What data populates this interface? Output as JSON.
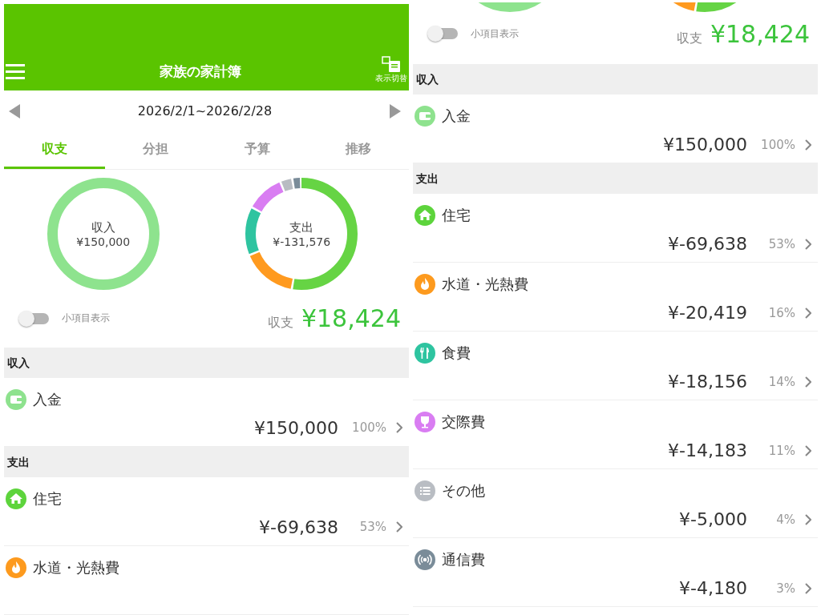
{
  "panels": [
    {
      "kind": "top",
      "header": {
        "title": "家族の家計簿",
        "view_toggle_label": "表示切替"
      },
      "date_range": "2026/2/1~2026/2/28",
      "tabs": [
        {
          "label": "収支",
          "selected": true
        },
        {
          "label": "分担",
          "selected": false
        },
        {
          "label": "予算",
          "selected": false
        },
        {
          "label": "推移",
          "selected": false
        }
      ],
      "donuts": [
        {
          "kind": "income",
          "label": "収入",
          "amount": "¥150,000"
        },
        {
          "kind": "expense",
          "label": "支出",
          "amount": "¥-131,576"
        }
      ],
      "subitem_toggle": {
        "label": "小項目表示",
        "on": false
      },
      "balance": {
        "label": "収支",
        "amount": "¥18,424"
      },
      "sections": [
        {
          "title": "収入",
          "rows": [
            {
              "kind": "deposit",
              "name": "入金",
              "color": "#8ee28e",
              "amount": "¥150,000",
              "percent": "100%"
            }
          ]
        },
        {
          "title": "支出",
          "rows": [
            {
              "kind": "housing",
              "name": "住宅",
              "color": "#5dd43c",
              "amount": "¥-69,638",
              "percent": "53%"
            },
            {
              "kind": "utilities",
              "name": "水道・光熱費",
              "color": "#fd9a1e"
            }
          ]
        }
      ]
    },
    {
      "kind": "scrolled",
      "donuts": [
        {
          "kind": "income"
        },
        {
          "kind": "expense"
        }
      ],
      "subitem_toggle": {
        "label": "小項目表示",
        "on": false
      },
      "balance": {
        "label": "収支",
        "amount": "¥18,424"
      },
      "sections": [
        {
          "title": "収入",
          "rows": [
            {
              "kind": "deposit",
              "name": "入金",
              "color": "#8ee28e",
              "amount": "¥150,000",
              "percent": "100%"
            }
          ]
        },
        {
          "title": "支出",
          "rows": [
            {
              "kind": "housing",
              "name": "住宅",
              "color": "#5dd43c",
              "amount": "¥-69,638",
              "percent": "53%"
            },
            {
              "kind": "utilities",
              "name": "水道・光熱費",
              "color": "#fd9a1e",
              "amount": "¥-20,419",
              "percent": "16%"
            },
            {
              "kind": "food",
              "name": "食費",
              "color": "#2ec4a0",
              "amount": "¥-18,156",
              "percent": "14%"
            },
            {
              "kind": "social",
              "name": "交際費",
              "color": "#d97df2",
              "amount": "¥-14,183",
              "percent": "11%"
            },
            {
              "kind": "other",
              "name": "その他",
              "color": "#b9bdc3",
              "amount": "¥-5,000",
              "percent": "4%"
            },
            {
              "kind": "telecom",
              "name": "通信費",
              "color": "#7a8c99",
              "amount": "¥-4,180",
              "percent": "3%"
            }
          ]
        }
      ]
    }
  ]
}
